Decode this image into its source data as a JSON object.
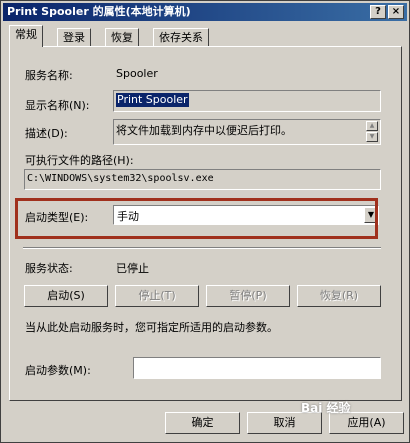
{
  "window": {
    "title": "Print Spooler 的属性(本地计算机)",
    "help_btn": "?",
    "close_btn": "×"
  },
  "tabs": [
    "常规",
    "登录",
    "恢复",
    "依存关系"
  ],
  "general": {
    "service_name_label": "服务名称:",
    "service_name": "Spooler",
    "display_name_label": "显示名称(N):",
    "display_name": "Print Spooler",
    "description_label": "描述(D):",
    "description": "将文件加载到内存中以便迟后打印。",
    "exe_path_label": "可执行文件的路径(H):",
    "exe_path": "C:\\WINDOWS\\system32\\spoolsv.exe",
    "startup_type_label": "启动类型(E):",
    "startup_type": "手动",
    "service_status_label": "服务状态:",
    "service_status": "已停止",
    "buttons": {
      "start": "启动(S)",
      "stop": "停止(T)",
      "pause": "暂停(P)",
      "resume": "恢复(R)"
    },
    "hint": "当从此处启动服务时，您可指定所适用的启动参数。",
    "start_params_label": "启动参数(M):",
    "start_params": ""
  },
  "footer": {
    "ok": "确定",
    "cancel": "取消",
    "apply": "应用(A)"
  },
  "watermark": "Bai 经验"
}
